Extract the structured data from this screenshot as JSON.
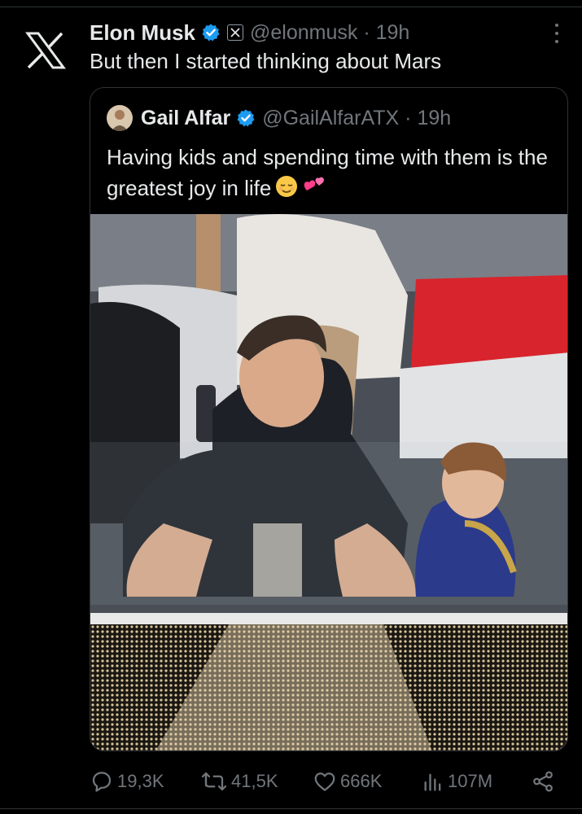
{
  "tweet": {
    "author_name": "Elon Musk",
    "handle_time": "@elonmusk · 19h",
    "text": "But then I started thinking about Mars"
  },
  "quote": {
    "author_name": "Gail Alfar",
    "handle_time": "@GailAlfarATX · 19h",
    "text": "Having kids and spending time with them is the greatest joy in life"
  },
  "actions": {
    "replies": "19,3K",
    "reposts": "41,5K",
    "likes": "666K",
    "views": "107M"
  },
  "colors": {
    "background": "#000000",
    "text": "#e7e9ea",
    "muted": "#71767b",
    "verified": "#1d9bf0",
    "border": "#2f3336"
  },
  "icons": [
    "x-logo-icon",
    "verified-badge-icon",
    "x-affiliate-badge-icon",
    "more-options-icon",
    "reply-icon",
    "repost-icon",
    "like-icon",
    "views-icon",
    "share-icon",
    "relieved-face-emoji",
    "two-hearts-emoji"
  ]
}
